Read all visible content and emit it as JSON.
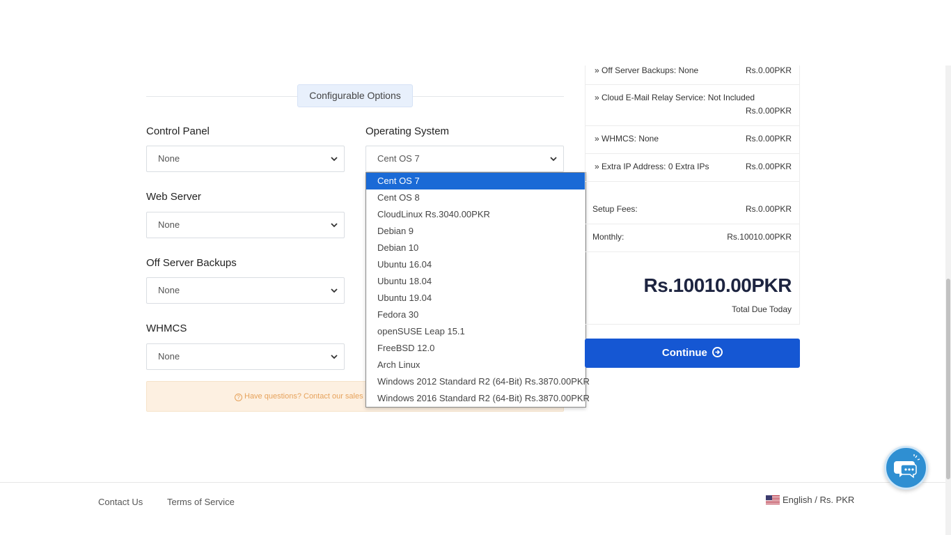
{
  "configurable_options": {
    "title": "Configurable Options"
  },
  "fields": {
    "control_panel": {
      "label": "Control Panel",
      "value": "None"
    },
    "operating_system": {
      "label": "Operating System",
      "value": "Cent OS 7"
    },
    "web_server": {
      "label": "Web Server",
      "value": "None"
    },
    "off_server_backups": {
      "label": "Off Server Backups",
      "value": "None"
    },
    "whmcs": {
      "label": "WHMCS",
      "value": "None"
    }
  },
  "os_dropdown": {
    "selected_index": 0,
    "options": [
      "Cent OS 7",
      "Cent OS 8",
      "CloudLinux Rs.3040.00PKR",
      "Debian 9",
      "Debian 10",
      "Ubuntu 16.04",
      "Ubuntu 18.04",
      "Ubuntu 19.04",
      "Fedora 30",
      "openSUSE Leap 15.1",
      "FreeBSD 12.0",
      "Arch Linux",
      "Windows 2012 Standard R2 (64-Bit) Rs.3870.00PKR",
      "Windows 2016 Standard R2 (64-Bit) Rs.3870.00PKR"
    ]
  },
  "help": {
    "text": "Have questions? Contact our sales"
  },
  "summary": {
    "items": [
      {
        "label": "» Off Server Backups: None",
        "value": "Rs.0.00PKR"
      },
      {
        "label": "» Cloud E-Mail Relay Service: Not Included",
        "value": "Rs.0.00PKR"
      },
      {
        "label": "» WHMCS: None",
        "value": "Rs.0.00PKR"
      },
      {
        "label": "» Extra IP Address: 0 Extra IPs",
        "value": "Rs.0.00PKR"
      }
    ],
    "setup_fees": {
      "label": "Setup Fees:",
      "value": "Rs.0.00PKR"
    },
    "monthly": {
      "label": "Monthly:",
      "value": "Rs.10010.00PKR"
    },
    "total_amount": "Rs.10010.00PKR",
    "total_label": "Total Due Today"
  },
  "continue_button": {
    "label": "Continue"
  },
  "footer": {
    "links": [
      "Contact Us",
      "Terms of Service"
    ],
    "language": "English / Rs. PKR"
  },
  "colors": {
    "primary": "#1557d3",
    "selected_option": "#1a6ad6",
    "alert_bg": "#fdf0e1",
    "alert_text": "#e6a25b"
  }
}
